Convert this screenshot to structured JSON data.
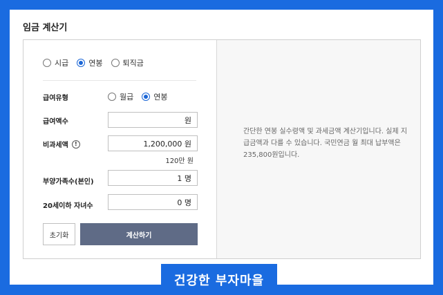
{
  "title": "임금 계산기",
  "mode_options": [
    {
      "label": "시급",
      "selected": false
    },
    {
      "label": "연봉",
      "selected": true
    },
    {
      "label": "퇴직금",
      "selected": false
    }
  ],
  "pay_type": {
    "label": "급여유형",
    "options": [
      {
        "label": "월급",
        "selected": false
      },
      {
        "label": "연봉",
        "selected": true
      }
    ]
  },
  "pay_amount": {
    "label": "급여액수",
    "value": "원"
  },
  "nontax": {
    "label": "비과세액",
    "help": "!",
    "value": "1,200,000 원",
    "sub": "120만 원"
  },
  "dependents": {
    "label": "부양가족수(본인)",
    "value": "1 명"
  },
  "children": {
    "label": "20세이하 자녀수",
    "value": "0 명"
  },
  "buttons": {
    "reset": "초기화",
    "calc": "계산하기"
  },
  "info_text": "간단한 연봉 실수령액 및 과세금액 계산기입니다. 실제 지급금액과 다를 수 있습니다. 국민연금 월 최대 납부액은 235,800원입니다.",
  "watermark": "건강한 부자마을",
  "colors": {
    "accent": "#1b66d6",
    "background": "#1a6be0",
    "button": "#5f6b86"
  }
}
